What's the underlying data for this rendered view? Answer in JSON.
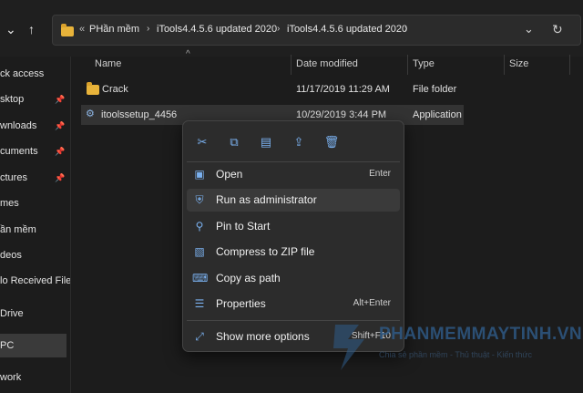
{
  "address_bar": {
    "overflow": "«",
    "crumbs": [
      "PHần mềm",
      "iTools4.4.5.6 updated 2020",
      "iTools4.4.5.6 updated 2020"
    ],
    "dropdown_icon": "chevron-down-icon",
    "refresh_icon": "refresh-icon"
  },
  "sidebar": {
    "items": [
      {
        "label": "ck access",
        "pinned": false
      },
      {
        "label": "sktop",
        "pinned": true
      },
      {
        "label": "wnloads",
        "pinned": true
      },
      {
        "label": "cuments",
        "pinned": true
      },
      {
        "label": "ctures",
        "pinned": true
      },
      {
        "label": "mes",
        "pinned": false
      },
      {
        "label": "ần mềm",
        "pinned": false
      },
      {
        "label": "deos",
        "pinned": false
      },
      {
        "label": "lo Received Files",
        "pinned": false
      },
      {
        "label": "Drive",
        "pinned": false
      },
      {
        "label": "PC",
        "pinned": false
      },
      {
        "label": "work",
        "pinned": false
      }
    ]
  },
  "columns": {
    "name": "Name",
    "date": "Date modified",
    "type": "Type",
    "size": "Size"
  },
  "files": [
    {
      "name": "Crack",
      "date": "11/17/2019 11:29 AM",
      "type": "File folder"
    },
    {
      "name": "itoolssetup_4456",
      "date": "10/29/2019 3:44 PM",
      "type": "Application"
    }
  ],
  "context_menu": {
    "quick_actions": [
      "cut-icon",
      "copy-icon",
      "rename-icon",
      "share-icon",
      "delete-icon"
    ],
    "items": [
      {
        "label": "Open",
        "shortcut": "Enter",
        "icon": "open-icon"
      },
      {
        "label": "Run as administrator",
        "shortcut": "",
        "icon": "shield-icon"
      },
      {
        "label": "Pin to Start",
        "shortcut": "",
        "icon": "pin-icon"
      },
      {
        "label": "Compress to ZIP file",
        "shortcut": "",
        "icon": "zip-icon"
      },
      {
        "label": "Copy as path",
        "shortcut": "",
        "icon": "copy-path-icon"
      },
      {
        "label": "Properties",
        "shortcut": "Alt+Enter",
        "icon": "properties-icon"
      },
      {
        "label": "Show more options",
        "shortcut": "Shift+F10",
        "icon": "more-options-icon"
      }
    ]
  },
  "watermark": {
    "text": "PHANMEMMAYTINH.VN",
    "subtitle": "Chia sẻ phần mềm - Thủ thuật - Kiến thức"
  }
}
